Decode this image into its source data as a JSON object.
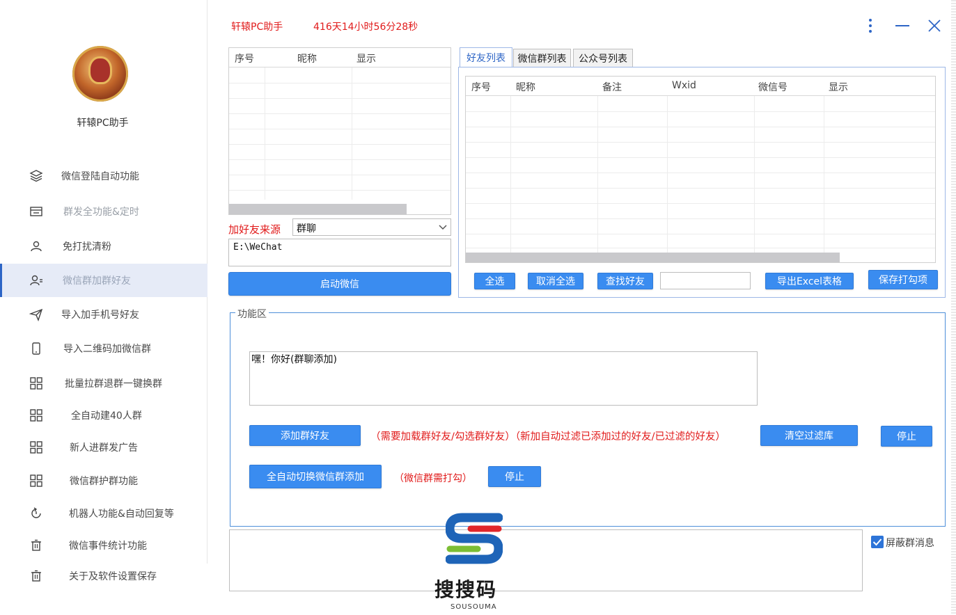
{
  "app": {
    "name": "轩辕PC助手",
    "title": "轩辕PC助手",
    "timer": "416天14小时56分28秒"
  },
  "sidebar": {
    "items": [
      {
        "label": "微信登陆自动功能",
        "icon": "layers-icon"
      },
      {
        "label": "群发全功能&定时",
        "icon": "folder-icon"
      },
      {
        "label": "免打扰清粉",
        "icon": "user-icon"
      },
      {
        "label": "微信群加群好友",
        "icon": "user-group-icon"
      },
      {
        "label": "导入加手机号好友",
        "icon": "send-icon"
      },
      {
        "label": "导入二维码加微信群",
        "icon": "phone-icon"
      },
      {
        "label": "批量拉群退群一键换群",
        "icon": "grid-icon"
      },
      {
        "label": "全自动建40人群",
        "icon": "grid-icon"
      },
      {
        "label": "新人进群发广告",
        "icon": "grid-icon"
      },
      {
        "label": "微信群护群功能",
        "icon": "grid-icon"
      },
      {
        "label": "机器人功能&自动回复等",
        "icon": "refresh-icon"
      },
      {
        "label": "微信事件统计功能",
        "icon": "trash-icon"
      },
      {
        "label": "关于及软件设置保存",
        "icon": "trash-icon"
      }
    ]
  },
  "left_grid": {
    "columns": [
      "序号",
      "昵称",
      "显示"
    ]
  },
  "source": {
    "label": "加好友来源",
    "selected": "群聊",
    "path": "E:\\WeChat"
  },
  "launch_button": "启动微信",
  "tabs": [
    "好友列表",
    "微信群列表",
    "公众号列表"
  ],
  "friend_grid": {
    "columns": [
      "序号",
      "昵称",
      "备注",
      "Wxid",
      "微信号",
      "显示"
    ]
  },
  "toolbar": {
    "select_all": "全选",
    "deselect_all": "取消全选",
    "find_friend": "查找好友",
    "search_value": "",
    "export_excel": "导出Excel表格",
    "save_checks": "保存打勾项"
  },
  "function_area": {
    "legend": "功能区",
    "message": "嘿！你好(群聊添加)",
    "add_group_friends": "添加群好友",
    "hint1": "（需要加载群好友/勾选群好友）（新加自动过滤已添加过的好友/已过滤的好友）",
    "clear_filter": "清空过滤库",
    "stop1": "停止",
    "auto_switch": "全自动切换微信群添加",
    "hint2": "（微信群需打勾）",
    "stop2": "停止"
  },
  "log": {
    "value": ""
  },
  "block_group_msg": {
    "label": "屏蔽群消息",
    "checked": true
  },
  "watermark": {
    "text": "搜搜码",
    "sub": "SOUSOUMA"
  },
  "colors": {
    "accent": "#3a8cf0",
    "alert": "#e11b1b",
    "active_nav": "#e6ebf7"
  }
}
